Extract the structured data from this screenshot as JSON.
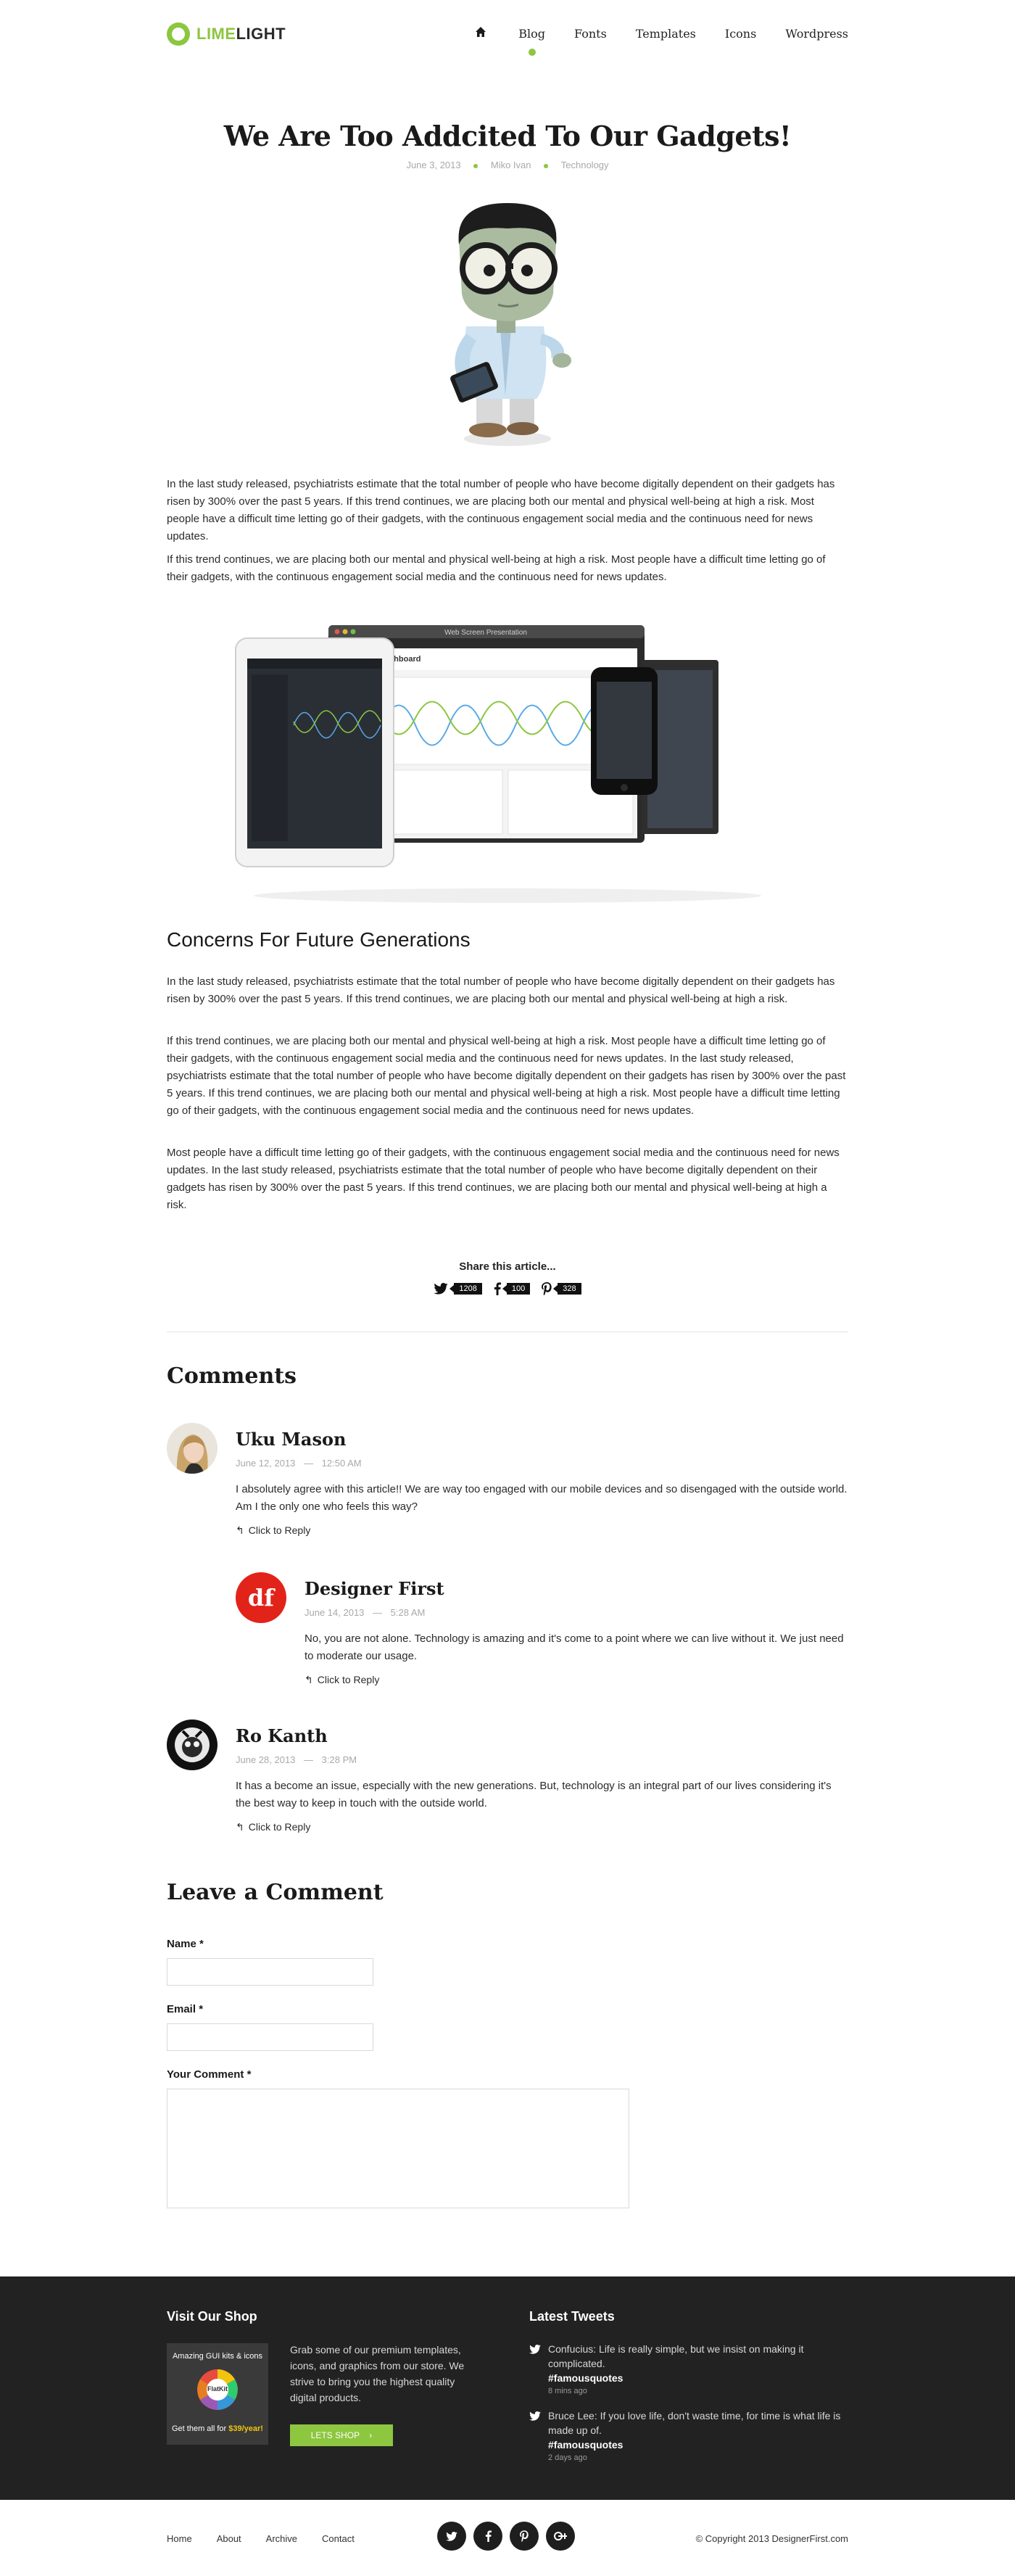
{
  "header": {
    "logo_lime": "LIME",
    "logo_light": "LIGHT",
    "nav": [
      "Blog",
      "Fonts",
      "Templates",
      "Icons",
      "Wordpress"
    ]
  },
  "article": {
    "title": "We Are Too Addcited To Our Gadgets!",
    "date": "June 3, 2013",
    "author": "Miko Ivan",
    "category": "Technology",
    "p1": "In the last study released, psychiatrists estimate that the total number of people who have become digitally dependent on their gadgets has risen by 300% over the past 5 years. If this trend continues, we are placing both our mental and physical well-being at high a risk. Most people have a difficult time letting go of their gadgets, with the continuous engagement social media and the continuous need for news updates.",
    "p2": "If this trend continues, we are placing both our mental and physical well-being at high a risk. Most people have a difficult time letting go of their gadgets, with the continuous engagement social media and the continuous need for news updates.",
    "subheading": "Concerns For Future Generations",
    "p3": "In the last study released, psychiatrists estimate that the total number of people who have become digitally dependent on their gadgets has risen by 300% over the past 5 years. If this trend continues, we are placing both our mental and physical well-being at high a risk.",
    "p4": "If this trend continues, we are placing both our mental and physical well-being at high a risk. Most people have a difficult time letting go of their gadgets, with the continuous engagement social media and the continuous need for news updates. In the last study released, psychiatrists estimate that the total number of people who have become digitally dependent on their gadgets has risen by 300% over the past 5 years. If this trend continues, we are placing both our mental and physical well-being at high a risk. Most people have a difficult time letting go of their gadgets, with the continuous engagement social media and the continuous need for news updates.",
    "p5": "Most people have a difficult time letting go of their gadgets, with the continuous engagement social media and the continuous need for news updates. In the last study released, psychiatrists estimate that the total number of people who have become digitally dependent on their gadgets has risen by 300% over the past 5 years. If this trend continues, we are placing both our mental and physical well-being at high a risk.",
    "mockup_window_title": "Web Screen Presentation",
    "mockup_dashboard": "Dashboard"
  },
  "share": {
    "title": "Share this article...",
    "twitter_count": "1208",
    "facebook_count": "100",
    "pinterest_count": "328"
  },
  "comments": {
    "title": "Comments",
    "reply_label": "Click to Reply",
    "separator": "—",
    "items": [
      {
        "name": "Uku Mason",
        "date": "June 12, 2013",
        "time": "12:50 AM",
        "text": "I absolutely agree with this article!! We are way too engaged with our mobile devices and so disengaged with the outside world. Am I the only one who feels this way?"
      },
      {
        "name": "Designer First",
        "avatar_text": "df",
        "date": "June 14, 2013",
        "time": "5:28 AM",
        "text": "No, you are not alone. Technology is amazing and it's come to a point where we can live without it. We just need to moderate our usage."
      },
      {
        "name": "Ro Kanth",
        "date": "June 28, 2013",
        "time": "3:28 PM",
        "text": "It has a become an issue, especially with the new generations. But, technology is an integral part of our lives considering it's the best way to keep in touch with the outside world."
      }
    ]
  },
  "form": {
    "title": "Leave a Comment",
    "name_label": "Name",
    "email_label": "Email",
    "comment_label": "Your Comment",
    "required": "*"
  },
  "footer": {
    "shop_title": "Visit Our Shop",
    "shop_img_line1": "Amazing GUI kits & icons",
    "shop_img_brand": "FlatKit",
    "shop_img_line2_a": "Get them all for ",
    "shop_img_price": "$39/year!",
    "shop_text": "Grab some of our premium templates, icons, and graphics from our store. We strive to bring you the highest quality digital products.",
    "shop_button": "LETS SHOP",
    "tweets_title": "Latest Tweets",
    "tweets": [
      {
        "text": "Confucius: Life is really simple, but we insist on making it complicated.",
        "tag": "#famousquotes",
        "time": "8 mins ago"
      },
      {
        "text": "Bruce Lee: If you love life, don't waste time, for time is what life is made up of.",
        "tag": "#famousquotes",
        "time": "2 days ago"
      }
    ],
    "links": [
      "Home",
      "About",
      "Archive",
      "Contact"
    ],
    "copyright": "© Copyright 2013 DesignerFirst.com"
  },
  "colors": {
    "accent": "#8dc63f",
    "footer_bg": "#222222",
    "df_red": "#e2231a"
  },
  "icons": [
    "home-icon",
    "twitter-icon",
    "facebook-icon",
    "pinterest-icon",
    "reply-icon",
    "google-plus-icon",
    "chevron-right-icon"
  ]
}
